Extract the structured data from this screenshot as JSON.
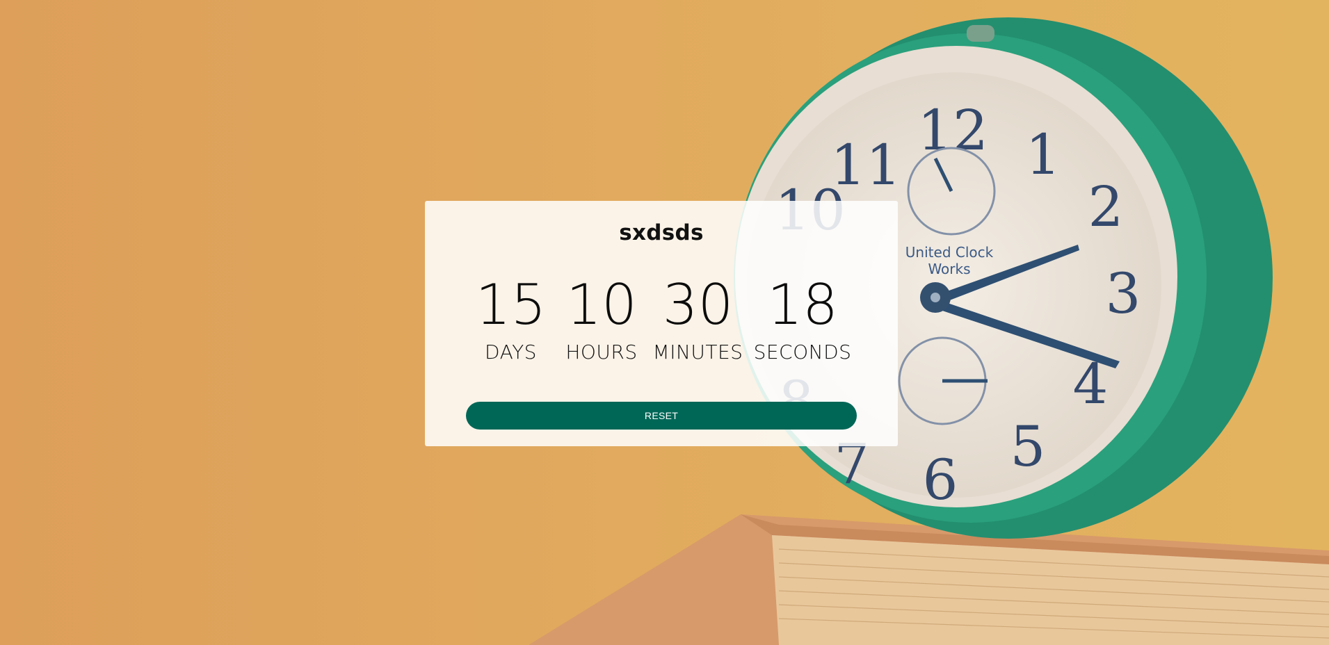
{
  "countdown": {
    "title": "sxdsds",
    "units": [
      {
        "value": "15",
        "label": "DAYS"
      },
      {
        "value": "10",
        "label": "HOURS"
      },
      {
        "value": "30",
        "label": "MINUTES"
      },
      {
        "value": "18",
        "label": "SECONDS"
      }
    ],
    "reset_label": "RESET"
  },
  "background": {
    "description_icon": "alarm-clock-on-book",
    "clock_text": "United Clock Works",
    "colors": {
      "backdrop": "#e0a860",
      "clock_rim": "#1f9a78",
      "button": "#006757"
    }
  }
}
